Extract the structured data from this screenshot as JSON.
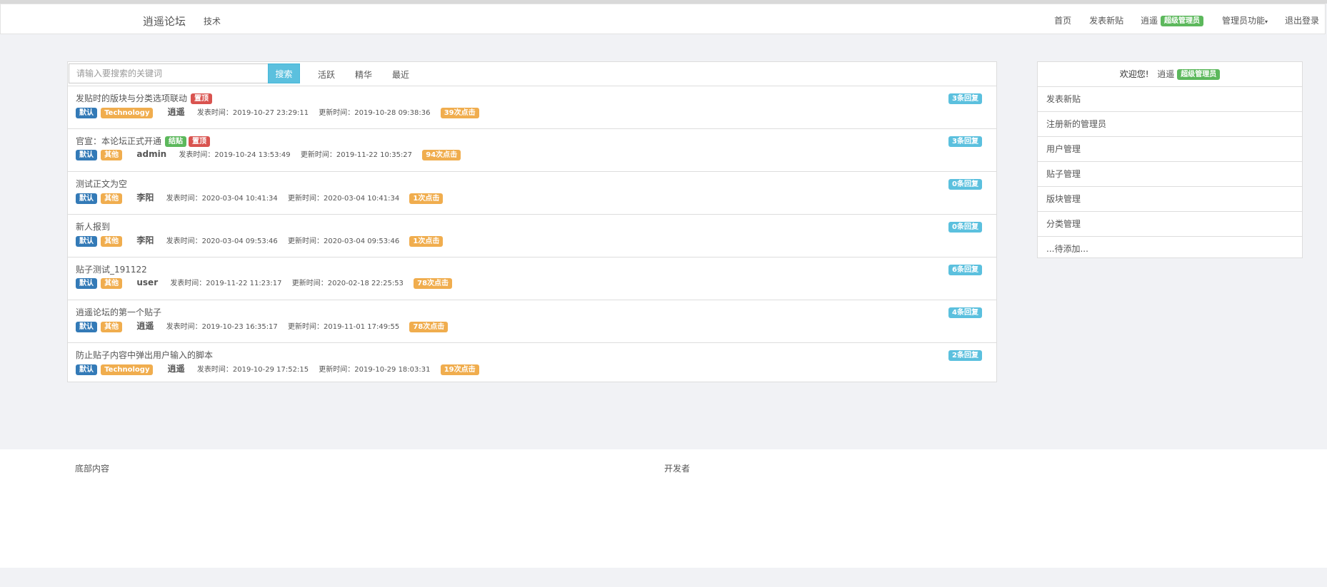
{
  "navbar": {
    "brand": "逍遥论坛",
    "tech": "技术",
    "home": "首页",
    "new_post": "发表新贴",
    "username": "逍遥",
    "role_badge": "超级管理员",
    "admin_menu": "管理员功能",
    "logout": "退出登录"
  },
  "search": {
    "placeholder": "请输入要搜索的关键词",
    "button": "搜索",
    "filters": [
      "活跃",
      "精华",
      "最近"
    ]
  },
  "posts": [
    {
      "title": "发贴时的版块与分类选项联动",
      "flags": [
        "置顶"
      ],
      "board": "默认",
      "category": "Technology",
      "author": "逍遥",
      "created": "发表时间：2019-10-27 23:29:11",
      "updated": "更新时间：2019-10-28 09:38:36",
      "clicks": "39次点击",
      "replies": "3条回复"
    },
    {
      "title": "官宣：本论坛正式开通",
      "flags": [
        "结贴",
        "置顶"
      ],
      "board": "默认",
      "category": "其他",
      "author": "admin",
      "created": "发表时间：2019-10-24 13:53:49",
      "updated": "更新时间：2019-11-22 10:35:27",
      "clicks": "94次点击",
      "replies": "3条回复"
    },
    {
      "title": "测试正文为空",
      "flags": [],
      "board": "默认",
      "category": "其他",
      "author": "李阳",
      "created": "发表时间：2020-03-04 10:41:34",
      "updated": "更新时间：2020-03-04 10:41:34",
      "clicks": "1次点击",
      "replies": "0条回复"
    },
    {
      "title": "新人报到",
      "flags": [],
      "board": "默认",
      "category": "其他",
      "author": "李阳",
      "created": "发表时间：2020-03-04 09:53:46",
      "updated": "更新时间：2020-03-04 09:53:46",
      "clicks": "1次点击",
      "replies": "0条回复"
    },
    {
      "title": "贴子测试_191122",
      "flags": [],
      "board": "默认",
      "category": "其他",
      "author": "user",
      "created": "发表时间：2019-11-22 11:23:17",
      "updated": "更新时间：2020-02-18 22:25:53",
      "clicks": "78次点击",
      "replies": "6条回复"
    },
    {
      "title": "逍遥论坛的第一个贴子",
      "flags": [],
      "board": "默认",
      "category": "其他",
      "author": "逍遥",
      "created": "发表时间：2019-10-23 16:35:17",
      "updated": "更新时间：2019-11-01 17:49:55",
      "clicks": "78次点击",
      "replies": "4条回复"
    },
    {
      "title": "防止贴子内容中弹出用户输入的脚本",
      "flags": [],
      "board": "默认",
      "category": "Technology",
      "author": "逍遥",
      "created": "发表时间：2019-10-29 17:52:15",
      "updated": "更新时间：2019-10-29 18:03:31",
      "clicks": "19次点击",
      "replies": "2条回复"
    }
  ],
  "sidebar": {
    "welcome": "欢迎您!",
    "username": "逍遥",
    "role_badge": "超级管理员",
    "items": [
      "发表新贴",
      "注册新的管理员",
      "用户管理",
      "贴子管理",
      "版块管理",
      "分类管理",
      "...待添加..."
    ]
  },
  "footer": {
    "left": "底部内容",
    "right": "开发者"
  },
  "colors": {
    "success": "#5cb85c",
    "danger": "#d9534f",
    "primary": "#337ab7",
    "warning": "#f0ad4e",
    "info": "#5bc0de"
  }
}
